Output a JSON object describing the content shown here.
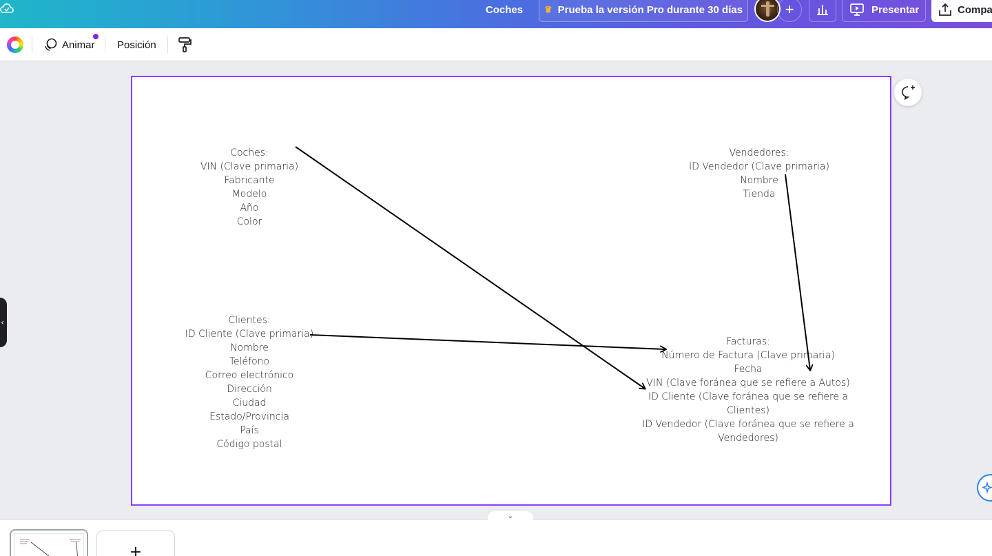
{
  "header": {
    "doc_title": "Coches",
    "pro_trial_label": "Prueba la versión Pro durante 30 días",
    "add_label": "+",
    "present_label": "Presentar",
    "share_label": "Compa"
  },
  "toolbar": {
    "animate_label": "Animar",
    "position_label": "Posición"
  },
  "diagram": {
    "coches": [
      "Coches:",
      "VIN (Clave primaria)",
      "Fabricante",
      "Modelo",
      "Año",
      "Color"
    ],
    "vendedores": [
      "Vendedores:",
      "ID Vendedor (Clave primaria)",
      "Nombre",
      "Tienda"
    ],
    "clientes": [
      "Clientes:",
      "ID Cliente (Clave primaria)",
      "Nombre",
      "Teléfono",
      "Correo electrónico",
      "Dirección",
      "Ciudad",
      "Estado/Provincia",
      "País",
      "Código postal"
    ],
    "facturas": [
      "Facturas:",
      "Número de Factura (Clave primaria)",
      "Fecha",
      "VIN (Clave foránea que se refiere a Autos)",
      "ID Cliente (Clave foránea que se refiere a",
      "Clientes)",
      "ID Vendedor (Clave foránea que se refiere a",
      "Vendedores)"
    ]
  },
  "bottom": {
    "add_page_label": "+"
  },
  "colors": {
    "selection_border": "#8b3dff",
    "crown": "#f9b530",
    "notification_dot": "#7d2ae8"
  },
  "icons": {
    "save_status": "cloud-check-icon",
    "pro": "crown-icon",
    "insights": "bar-chart-icon",
    "present": "presentation-play-icon",
    "share": "upload-icon",
    "animate": "animate-icon",
    "paint": "paint-roller-icon",
    "comment": "add-comment-icon",
    "magic": "sparkle-icon",
    "collapse": "chevron-down-icon"
  }
}
